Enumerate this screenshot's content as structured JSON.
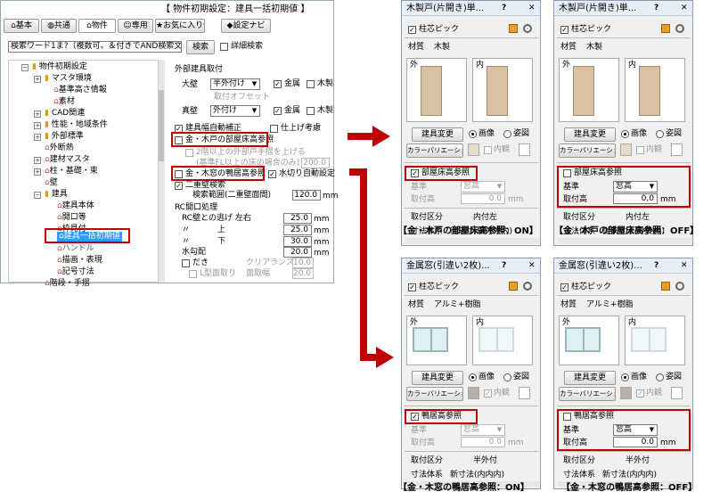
{
  "main": {
    "title": "【 物件初期設定：建具一括初期値 】",
    "toolbar": [
      "基本",
      "共通",
      "物件",
      "専用",
      "お気に入り",
      "設定ナビ"
    ],
    "search_placeholder": "検索ワード1ま?（複数可。＆付きでAND検索文字）",
    "search_button": "検索",
    "detail_search": "詳細検索",
    "tree": [
      "物件初期設定",
      "マスタ環境",
      "基準高さ情報",
      "素材",
      "CAD関連",
      "性能・地域条件",
      "外部標準",
      "外断熱",
      "建材マスタ",
      "柱・基礎・束",
      "壁",
      "建具",
      "建具本体",
      "開口等",
      "枠見付",
      "建具一括初期値",
      "ハンドル",
      "描画・表現",
      "記号寸法",
      "階段・手摺"
    ],
    "group_exterior": "外部建具取付",
    "outer_wall": "大壁",
    "outer_wall_value": "半外付け",
    "kindo": "金属",
    "mokusei": "木製",
    "mount_offset": "取付オフセット",
    "shinkabe": "真壁",
    "shinkabe_value": "外付け",
    "auto_correct": "建具幅自動補正",
    "finish_consider": "仕上げ考慮",
    "wood_door_ref": "金・木戸の部屋床高参照",
    "second_floor_door": "2階以上の外部戸手摺を上げる",
    "base_height_note": "(基準FL以上の床の場合のみ)",
    "base_height_value": "200.0",
    "wood_window_ref": "金・木窓の鴨居高参照",
    "auto_cut": "水切り自動設定",
    "double_wall": "二重壁検索",
    "search_range": "検索範囲(二重壁面間)",
    "search_range_value": "120.0",
    "mm": "mm",
    "rc_group": "RC開口処理",
    "rc_rows": [
      {
        "label": "RC壁との逃げ 左右",
        "value": "25.0"
      },
      {
        "label": "〃",
        "sub": "上",
        "value": "25.0"
      },
      {
        "label": "〃",
        "sub": "下",
        "value": "30.0"
      },
      {
        "label": "水勾配",
        "value": "20.0"
      }
    ],
    "dakki": "だき",
    "clearance": "クリアランス",
    "clearance_value": "10.0",
    "slope_chamfer": "L型面取り",
    "chamfer_width": "面取幅",
    "chamfer_value": "20.0"
  },
  "panels": [
    {
      "title": "木製戸(片開き)単...",
      "core_pick": "柱芯ピック",
      "material_label": "材質",
      "material": "木製",
      "out_label": "外",
      "in_label": "内",
      "change_button": "建具変更",
      "image_label": "画像",
      "elevation_label": "姿図",
      "color_button": "カラーバリエーション",
      "inner_label": "内観",
      "ref_label": "部屋床高参照",
      "ref_checked": true,
      "base_label": "基準",
      "base_value": "窓高",
      "height_label": "取付高",
      "height_value": "0.0",
      "mm": "mm",
      "section_label": "取付区分",
      "section_value": "内付左",
      "dim_label": "寸法体系",
      "dim_value": "従来寸法(外外内)",
      "caption": "【金・木戸の部屋床高参照：ON】"
    },
    {
      "title": "木製戸(片開き)単...",
      "core_pick": "柱芯ピック",
      "material_label": "材質",
      "material": "木製",
      "out_label": "外",
      "in_label": "内",
      "change_button": "建具変更",
      "image_label": "画像",
      "elevation_label": "姿図",
      "color_button": "カラーバリエーション",
      "inner_label": "内観",
      "ref_label": "部屋床高参照",
      "ref_checked": false,
      "base_label": "基準",
      "base_value": "窓高",
      "height_label": "取付高",
      "height_value": "0.0",
      "mm": "mm",
      "section_label": "取付区分",
      "section_value": "内付左",
      "dim_label": "寸法体系",
      "dim_value": "従来寸法(外外内)",
      "caption": "【金・木戸の部屋床高参照：OFF】"
    },
    {
      "title": "金属窓(引違い2枚)...",
      "core_pick": "柱芯ピック",
      "material_label": "材質",
      "material": "アルミ+樹脂",
      "out_label": "外",
      "in_label": "内",
      "change_button": "建具変更",
      "image_label": "画像",
      "elevation_label": "姿図",
      "color_button": "カラーバリエーション",
      "inner_label": "内観",
      "ref_label": "鴨居高参照",
      "ref_checked": true,
      "base_label": "基準",
      "base_value": "窓高",
      "height_label": "取付高",
      "height_value": "0.0",
      "mm": "mm",
      "section_label": "取付区分",
      "section_value": "半外付",
      "dim_label": "寸法体系",
      "dim_value": "新寸法(内内内)",
      "caption": "【金・木窓の鴨居高参照：ON】"
    },
    {
      "title": "金属窓(引違い2枚)...",
      "core_pick": "柱芯ピック",
      "material_label": "材質",
      "material": "アルミ+樹脂",
      "out_label": "外",
      "in_label": "内",
      "change_button": "建具変更",
      "image_label": "画像",
      "elevation_label": "姿図",
      "color_button": "カラーバリエーション",
      "inner_label": "内観",
      "ref_label": "鴨居高参照",
      "ref_checked": false,
      "base_label": "基準",
      "base_value": "窓高",
      "height_label": "取付高",
      "height_value": "0.0",
      "mm": "mm",
      "section_label": "取付区分",
      "section_value": "半外付",
      "dim_label": "寸法体系",
      "dim_value": "新寸法(内内内)",
      "caption": "【金・木窓の鴨居高参照：OFF】"
    }
  ],
  "colors": {
    "red": "#c00000"
  }
}
